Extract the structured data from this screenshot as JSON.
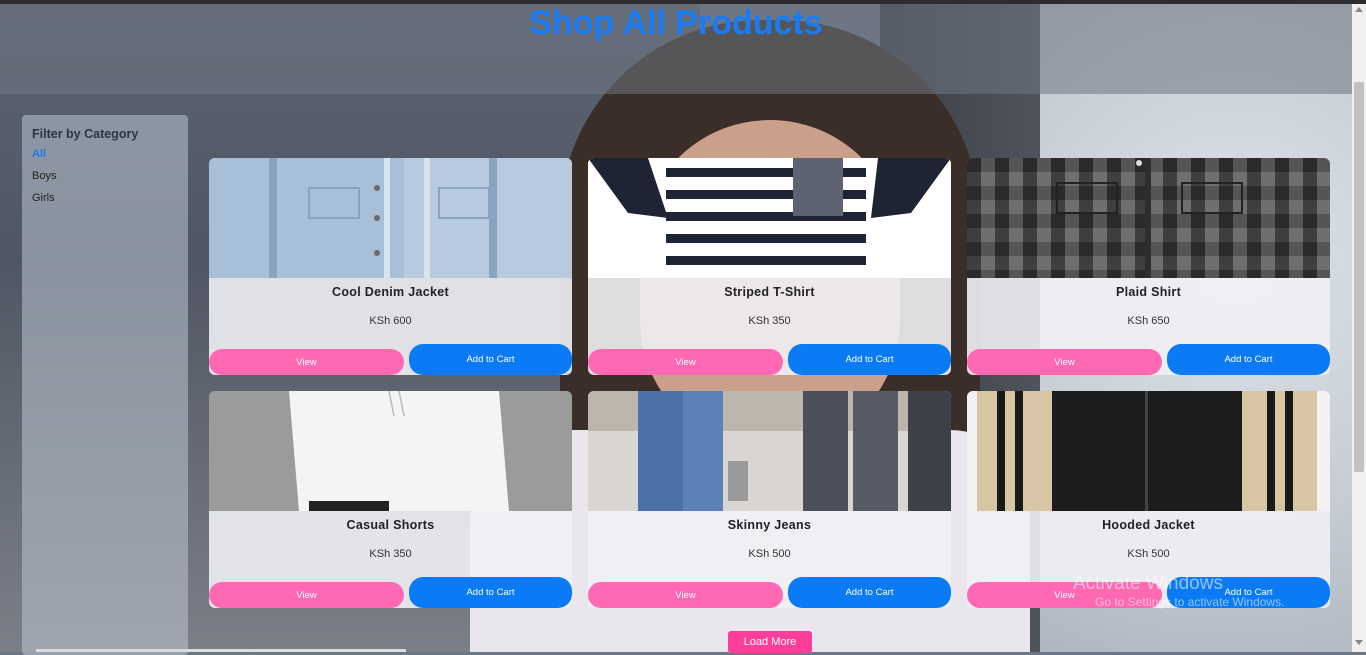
{
  "page": {
    "title": "Shop All Products"
  },
  "sidebar": {
    "heading": "Filter by Category",
    "categories": [
      {
        "label": "All",
        "active": true
      },
      {
        "label": "Boys",
        "active": false
      },
      {
        "label": "Girls",
        "active": false
      }
    ]
  },
  "products": [
    {
      "name": "Cool Denim Jacket",
      "price": "KSh 600",
      "view": "View",
      "cart": "Add to Cart"
    },
    {
      "name": "Striped T-Shirt",
      "price": "KSh 350",
      "view": "View",
      "cart": "Add to Cart"
    },
    {
      "name": "Plaid Shirt",
      "price": "KSh 650",
      "view": "View",
      "cart": "Add to Cart"
    },
    {
      "name": "Casual Shorts",
      "price": "KSh 350",
      "view": "View",
      "cart": "Add to Cart"
    },
    {
      "name": "Skinny Jeans",
      "price": "KSh 500",
      "view": "View",
      "cart": "Add to Cart"
    },
    {
      "name": "Hooded Jacket",
      "price": "KSh 500",
      "view": "View",
      "cart": "Add to Cart"
    }
  ],
  "load_more": "Load More",
  "watermark": {
    "line1": "Activate Windows",
    "line2": "Go to Settings to activate Windows."
  },
  "colors": {
    "accent": "#1a7cf5",
    "view_button": "#ff69b4",
    "cart_button": "#0a7bf5",
    "load_more": "#ff3e9a"
  }
}
